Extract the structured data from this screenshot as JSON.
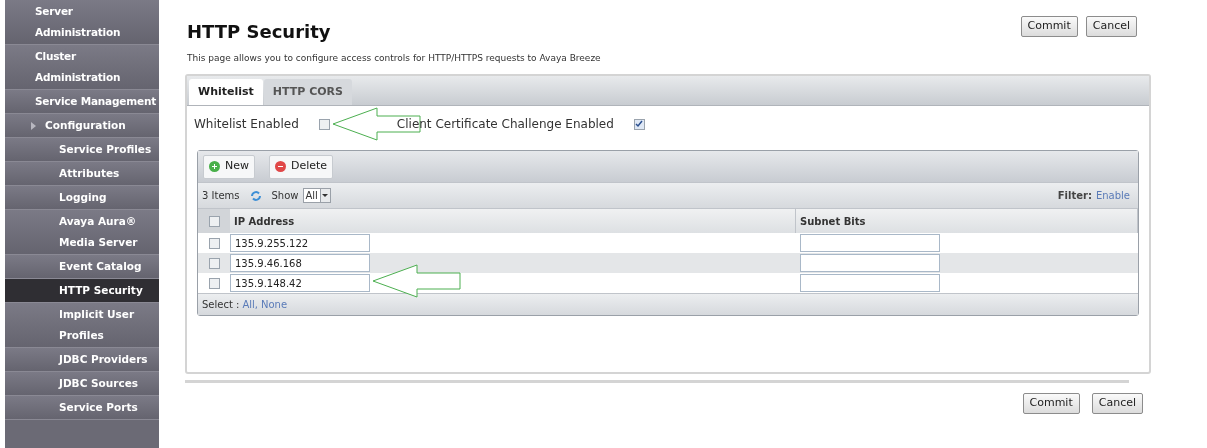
{
  "sidebar": {
    "items": [
      {
        "label": "Server Administration",
        "selected": false,
        "kind": "section"
      },
      {
        "label": "Cluster Administration",
        "selected": false,
        "kind": "section"
      },
      {
        "label": "Service Management",
        "selected": false,
        "kind": "section"
      },
      {
        "label": "Configuration",
        "selected": false,
        "kind": "group"
      },
      {
        "label": "Service Profiles",
        "selected": false,
        "kind": "child"
      },
      {
        "label": "Attributes",
        "selected": false,
        "kind": "child"
      },
      {
        "label": "Logging",
        "selected": false,
        "kind": "child"
      },
      {
        "label": "Avaya Aura® Media Server",
        "selected": false,
        "kind": "child"
      },
      {
        "label": "Event Catalog",
        "selected": false,
        "kind": "child"
      },
      {
        "label": "HTTP Security",
        "selected": true,
        "kind": "child"
      },
      {
        "label": "Implicit User Profiles",
        "selected": false,
        "kind": "child"
      },
      {
        "label": "JDBC Providers",
        "selected": false,
        "kind": "child"
      },
      {
        "label": "JDBC Sources",
        "selected": false,
        "kind": "child"
      },
      {
        "label": "Service Ports",
        "selected": false,
        "kind": "child"
      }
    ]
  },
  "page": {
    "title": "HTTP Security",
    "description": "This page allows you to configure access controls for HTTP/HTTPS requests to Avaya Breeze"
  },
  "top_buttons": [
    "Commit",
    "Cancel"
  ],
  "tabs": [
    {
      "label": "Whitelist",
      "selected": true
    },
    {
      "label": "HTTP CORS",
      "selected": false
    }
  ],
  "options": [
    {
      "label": "Whitelist Enabled",
      "checked": false
    },
    {
      "label": "Client Certificate Challenge Enabled",
      "checked": true
    }
  ],
  "toolbar": [
    {
      "label": "New",
      "kind": "add"
    },
    {
      "label": "Delete",
      "kind": "remove"
    }
  ],
  "grid": {
    "count": "3 Items",
    "show_label": "Show",
    "show_value": "All",
    "filter_label": "Filter:",
    "filter_link": "Enable",
    "header_checked": false,
    "columns": [
      "IP Address",
      "Subnet Bits"
    ],
    "rows": [
      {
        "checked": false,
        "ip": "135.9.255.122"
      },
      {
        "checked": false,
        "ip": "135.9.46.168"
      },
      {
        "checked": false,
        "ip": "135.9.148.42"
      }
    ],
    "select_label": "Select :",
    "select_links": [
      "All",
      "None"
    ],
    "select_separator": ","
  },
  "bottom_buttons": [
    "Commit",
    "Cancel"
  ]
}
